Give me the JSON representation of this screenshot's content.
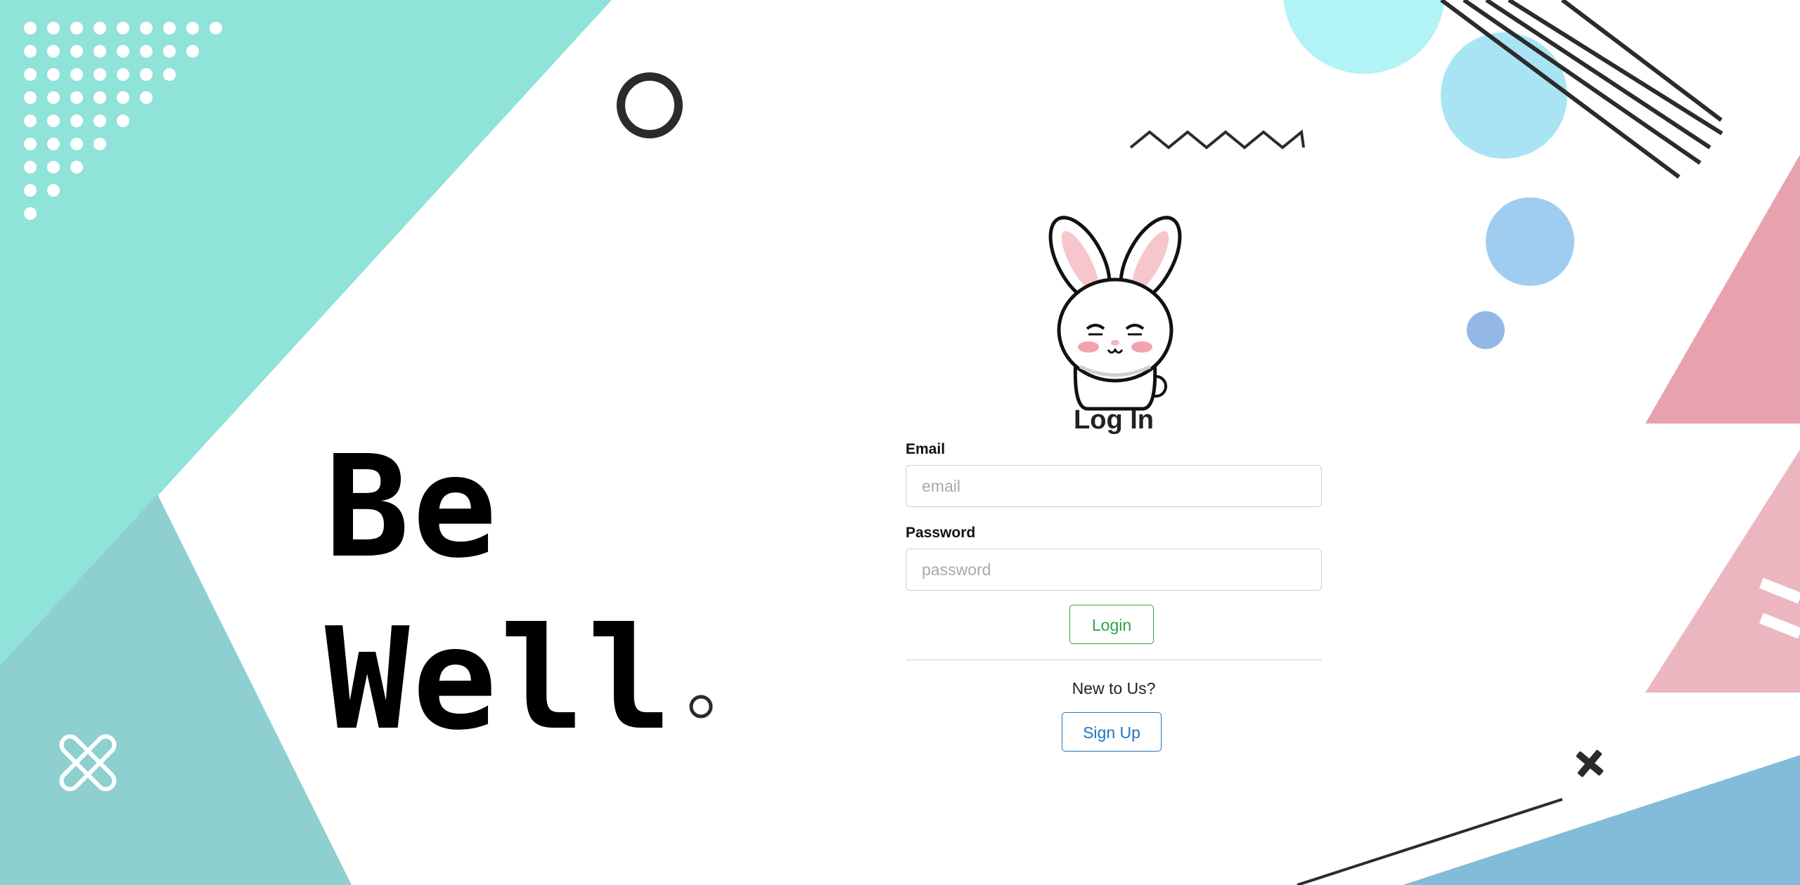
{
  "hero": {
    "line1": "Be",
    "line2": "Well"
  },
  "login": {
    "title": "Log In",
    "email_label": "Email",
    "email_placeholder": "email",
    "password_label": "Password",
    "password_placeholder": "password",
    "login_button": "Login",
    "new_prompt": "New to Us?",
    "signup_button": "Sign Up"
  },
  "colors": {
    "mint": "#8fe3d8",
    "teal": "#8ecfd0",
    "pink": "#e8a2ad",
    "light_pink": "#ecb6c1",
    "sky": "#a9e4f5",
    "blue": "#82bcd9",
    "login_green": "#28a745",
    "signup_blue": "#1f76c2"
  },
  "icons": [
    "bunny-mascot-icon",
    "ring-icon",
    "zigzag-icon",
    "cross-icon"
  ]
}
